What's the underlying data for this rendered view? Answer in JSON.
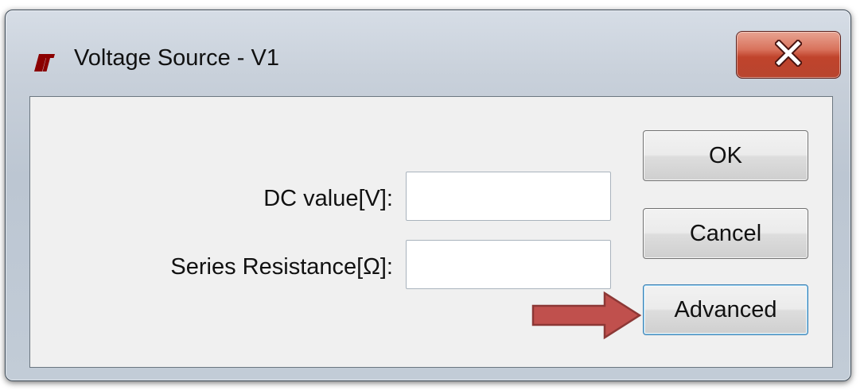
{
  "window": {
    "title": "Voltage Source - V1",
    "logo": "lt-logo-icon",
    "close_icon": "close-icon"
  },
  "form": {
    "dc_value_label": "DC value[V]:",
    "dc_value": "",
    "series_resistance_label": "Series Resistance[Ω]:",
    "series_resistance": ""
  },
  "buttons": {
    "ok_label": "OK",
    "cancel_label": "Cancel",
    "advanced_label": "Advanced"
  },
  "annotation": {
    "arrow_icon": "arrow-right-icon",
    "arrow_color": "#c0504d"
  },
  "colors": {
    "close_button": "#c0442c",
    "window_frame": "#c2ccd7",
    "client_bg": "#f0f0f0",
    "focus_border": "#3c7fb1"
  }
}
